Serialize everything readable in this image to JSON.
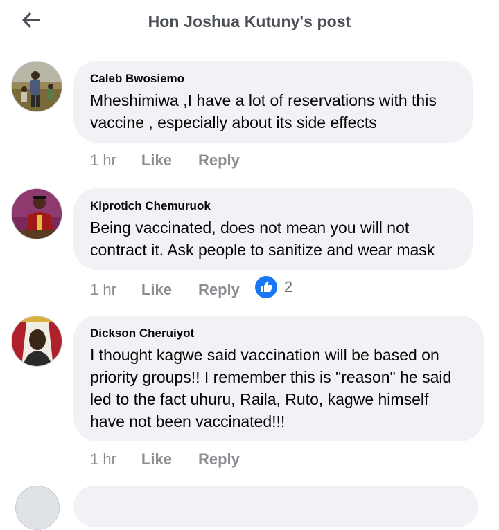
{
  "header": {
    "title": "Hon Joshua Kutuny's post",
    "back_icon": "arrow-left-icon"
  },
  "comments": [
    {
      "author": "Caleb Bwosiemo",
      "text_lines": [
        "Mheshimiwa ,I have a lot of reservations with this",
        "vaccine , especially about its side effects"
      ],
      "time": "1 hr",
      "like_label": "Like",
      "reply_label": "Reply"
    },
    {
      "author": "Kiprotich Chemuruok",
      "text_lines": [
        "Being vaccinated, does not mean you will not",
        "contract it. Ask people to sanitize and wear mask"
      ],
      "time": "1 hr",
      "like_label": "Like",
      "reply_label": "Reply",
      "reaction": {
        "icon": "thumbs-up-icon",
        "count": "2",
        "color": "#1877f2"
      }
    },
    {
      "author": "Dickson Cheruiyot",
      "text_lines": [
        "I thought kagwe said vaccination will be based on",
        "priority groups!! I remember this is \"reason\" he said",
        "led to the fact uhuru, Raila, Ruto, kagwe himself",
        "have not been vaccinated!!!"
      ],
      "time": "1 hr",
      "like_label": "Like",
      "reply_label": "Reply"
    }
  ],
  "colors": {
    "bubble": "#f0f2f5",
    "meta_text": "#8a8d91",
    "header_title": "#4b4f56",
    "like_blue": "#1877f2"
  }
}
